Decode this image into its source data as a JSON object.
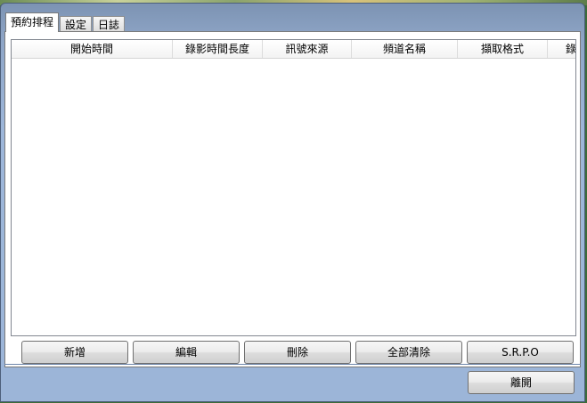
{
  "tabs": [
    {
      "label": "預約排程",
      "active": true
    },
    {
      "label": "設定",
      "active": false
    },
    {
      "label": "日誌",
      "active": false
    }
  ],
  "schedule_list": {
    "columns": [
      "開始時間",
      "錄影時間長度",
      "訊號來源",
      "頻道名稱",
      "擷取格式",
      "錄"
    ],
    "rows": []
  },
  "actions": {
    "add": "新增",
    "edit": "編輯",
    "delete": "刪除",
    "clear_all": "全部清除",
    "srpo": "S.R.P.O"
  },
  "footer": {
    "close": "離開"
  }
}
